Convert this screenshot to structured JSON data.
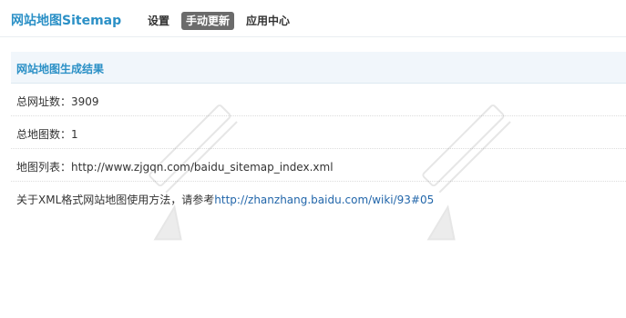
{
  "header": {
    "app_title": "网站地图Sitemap",
    "nav": [
      {
        "label": "设置"
      },
      {
        "label": "手动更新",
        "active": true
      },
      {
        "label": "应用中心"
      }
    ]
  },
  "section": {
    "title": "网站地图生成结果"
  },
  "rows": {
    "total_urls": "总网址数：3909",
    "total_maps": "总地图数：1",
    "map_list_prefix": "地图列表：",
    "map_list_url": "http://www.zjgqn.com/baidu_sitemap_index.xml",
    "help_prefix": "关于XML格式网站地图使用方法，请参考",
    "help_url": "http://zhanzhang.baidu.com/wiki/93#05"
  },
  "colors": {
    "accent": "#2b90c6",
    "link": "#2266aa",
    "active_tab_bg": "#6b6b6b",
    "section_bg": "#f1f6fb"
  }
}
